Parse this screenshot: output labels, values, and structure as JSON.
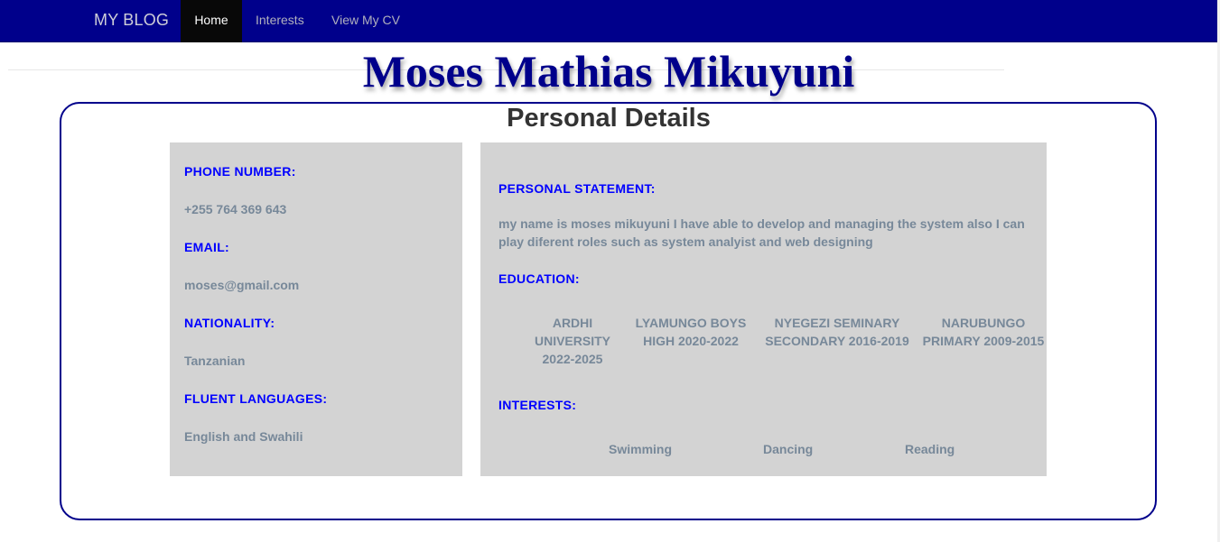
{
  "nav": {
    "brand": "MY BLOG",
    "items": [
      {
        "label": "Home",
        "active": true
      },
      {
        "label": "Interests",
        "active": false
      },
      {
        "label": "View My CV",
        "active": false
      }
    ]
  },
  "header": {
    "name": "Moses Mathias Mikuyuni"
  },
  "section": {
    "title": "Personal Details"
  },
  "contact": {
    "phone_label": "PHONE NUMBER:",
    "phone": "+255 764 369 643",
    "email_label": "EMAIL:",
    "email": "moses@gmail.com",
    "nationality_label": "NATIONALITY:",
    "nationality": "Tanzanian",
    "languages_label": "FLUENT LANGUAGES:",
    "languages": "English and Swahili"
  },
  "profile": {
    "statement_label": "PERSONAL STATEMENT:",
    "statement": "my name is moses mikuyuni I have able to develop and managing the system also I can play diferent roles such as system analyist and web designing",
    "education_label": "EDUCATION:",
    "education": [
      "ARDHI UNIVERSITY 2022-2025",
      "LYAMUNGO BOYS HIGH 2020-2022",
      "NYEGEZI SEMINARY SECONDARY 2016-2019",
      "NARUBUNGO PRIMARY 2009-2015"
    ],
    "interests_label": "INTERESTS:",
    "interests": [
      "Swimming",
      "Dancing",
      "Reading"
    ]
  },
  "colors": {
    "navbar": "#00008b",
    "active_tab": "#080808",
    "title": "#00008b",
    "label": "#0000ff",
    "value": "#778899",
    "panel": "#d3d3d3",
    "card_border": "#00008b"
  }
}
